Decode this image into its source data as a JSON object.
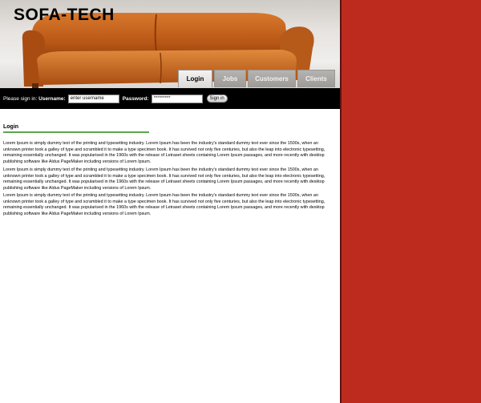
{
  "header": {
    "logo": "SOFA-TECH"
  },
  "nav": {
    "tabs": [
      {
        "label": "Login",
        "active": true
      },
      {
        "label": "Jobs",
        "active": false
      },
      {
        "label": "Customers",
        "active": false
      },
      {
        "label": "Clients",
        "active": false
      }
    ]
  },
  "login_bar": {
    "prompt": "Please sign in:",
    "username_label": "Username:",
    "username_value": "enter username",
    "password_label": "Password:",
    "password_value": "*********",
    "signin_label": "Sign in"
  },
  "content": {
    "title": "Login",
    "paragraphs": [
      "Lorem Ipsum is simply dummy text of the printing and typesetting industry. Lorem Ipsum has been the industry's standard dummy text ever since the 1500s, when an unknown printer took a galley of type and scrambled it to make a type specimen book. It has survived not only five centuries, but also the leap into electronic typesetting, remaining essentially unchanged. It was popularised in the 1960s with the release of Letraset sheets containing Lorem Ipsum passages, and more recently with desktop publishing software like Aldus PageMaker including versions of Lorem Ipsum.",
      "Lorem Ipsum is simply dummy text of the printing and typesetting industry. Lorem Ipsum has been the industry's standard dummy text ever since the 1500s, when an unknown printer took a galley of type and scrambled it to make a type specimen book. It has survived not only five centuries, but also the leap into electronic typesetting, remaining essentially unchanged. It was popularised in the 1960s with the release of Letraset sheets containing Lorem Ipsum passages, and more recently with desktop publishing software like Aldus PageMaker including versions of Lorem Ipsum.",
      "Lorem Ipsum is simply dummy text of the printing and typesetting industry. Lorem Ipsum has been the industry's standard dummy text ever since the 1500s, when an unknown printer took a galley of type and scrambled it to make a type specimen book. It has survived not only five centuries, but also the leap into electronic typesetting, remaining essentially unchanged. It was popularised in the 1960s with the release of Letraset sheets containing Lorem Ipsum passages, and more recently with desktop publishing software like Aldus PageMaker including versions of Lorem Ipsum."
    ]
  },
  "colors": {
    "side_panel": "#bd2b1f",
    "accent_underline": "#5aa64c",
    "login_bar": "#000000",
    "sofa": "#c8621f"
  }
}
